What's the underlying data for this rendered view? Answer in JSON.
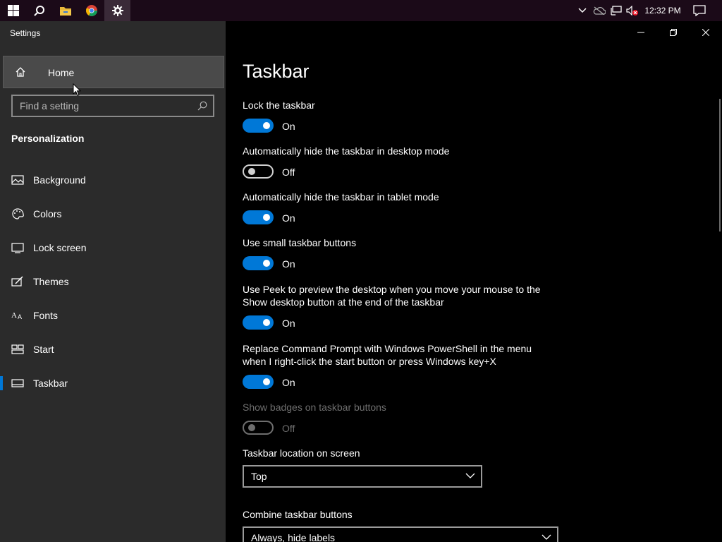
{
  "taskbar": {
    "clock": "12:32 PM",
    "icons": [
      "windows-start-icon",
      "search-icon",
      "file-explorer-icon",
      "chrome-icon",
      "settings-gear-icon"
    ],
    "tray_icons": [
      "chevron-up-icon",
      "onedrive-offline-icon",
      "network-icon",
      "volume-muted-icon",
      "action-center-icon"
    ]
  },
  "sidebar": {
    "app_title": "Settings",
    "home_label": "Home",
    "search_placeholder": "Find a setting",
    "section": "Personalization",
    "items": [
      {
        "label": "Background",
        "icon": "picture-icon"
      },
      {
        "label": "Colors",
        "icon": "palette-icon"
      },
      {
        "label": "Lock screen",
        "icon": "lock-screen-icon"
      },
      {
        "label": "Themes",
        "icon": "themes-brush-icon"
      },
      {
        "label": "Fonts",
        "icon": "fonts-icon"
      },
      {
        "label": "Start",
        "icon": "start-tiles-icon"
      },
      {
        "label": "Taskbar",
        "icon": "taskbar-icon",
        "selected": true
      }
    ]
  },
  "main": {
    "title": "Taskbar",
    "settings": [
      {
        "label": "Lock the taskbar",
        "state": "On"
      },
      {
        "label": "Automatically hide the taskbar in desktop mode",
        "state": "Off"
      },
      {
        "label": "Automatically hide the taskbar in tablet mode",
        "state": "On"
      },
      {
        "label": "Use small taskbar buttons",
        "state": "On"
      },
      {
        "label": "Use Peek to preview the desktop when you move your mouse to the Show desktop button at the end of the taskbar",
        "state": "On"
      },
      {
        "label": "Replace Command Prompt with Windows PowerShell in the menu when I right-click the start button or press Windows key+X",
        "state": "On"
      },
      {
        "label": "Show badges on taskbar buttons",
        "state": "Off",
        "disabled": true
      }
    ],
    "location": {
      "label": "Taskbar location on screen",
      "value": "Top"
    },
    "combine": {
      "label": "Combine taskbar buttons",
      "value": "Always, hide labels"
    }
  },
  "colors": {
    "accent": "#0078d7",
    "sidebar_bg": "#2b2b2b",
    "main_bg": "#000000",
    "taskbar_bg": "#1b0a18"
  }
}
